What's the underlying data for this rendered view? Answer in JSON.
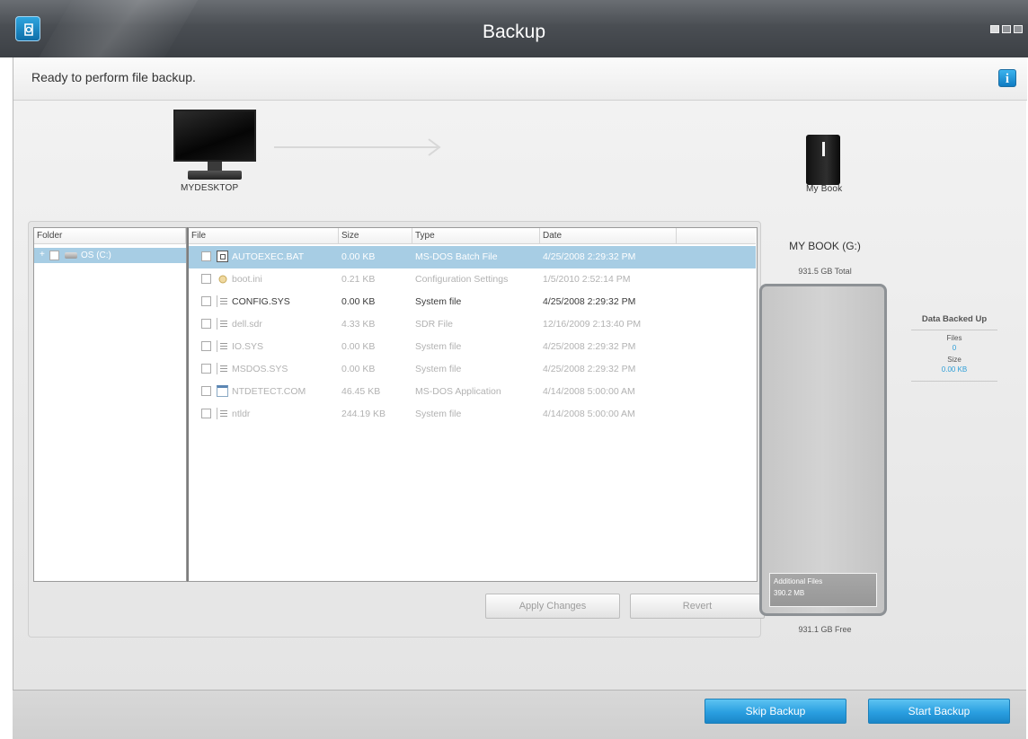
{
  "window": {
    "title": "Backup"
  },
  "status": {
    "text": "Ready to perform file backup."
  },
  "info_button": {
    "label": "i"
  },
  "devices": {
    "source": "MYDESKTOP",
    "destination": "My Book"
  },
  "browser": {
    "folder_header": "Folder",
    "tree": [
      {
        "label": "OS (C:)",
        "expander": "+"
      }
    ],
    "columns": [
      "File",
      "Size",
      "Type",
      "Date"
    ],
    "rows": [
      {
        "name": "AUTOEXEC.BAT",
        "size": "0.00 KB",
        "type": "MS-DOS Batch File",
        "date": "4/25/2008 2:29:32 PM",
        "icon": "batch-file-icon"
      },
      {
        "name": "boot.ini",
        "size": "0.21 KB",
        "type": "Configuration Settings",
        "date": "1/5/2010 2:52:14 PM",
        "icon": "settings-file-icon"
      },
      {
        "name": "CONFIG.SYS",
        "size": "0.00 KB",
        "type": "System file",
        "date": "4/25/2008 2:29:32 PM",
        "icon": "system-file-icon"
      },
      {
        "name": "dell.sdr",
        "size": "4.33 KB",
        "type": "SDR File",
        "date": "12/16/2009 2:13:40 PM",
        "icon": "text-file-icon"
      },
      {
        "name": "IO.SYS",
        "size": "0.00 KB",
        "type": "System file",
        "date": "4/25/2008 2:29:32 PM",
        "icon": "system-file-icon"
      },
      {
        "name": "MSDOS.SYS",
        "size": "0.00 KB",
        "type": "System file",
        "date": "4/25/2008 2:29:32 PM",
        "icon": "system-file-icon"
      },
      {
        "name": "NTDETECT.COM",
        "size": "46.45 KB",
        "type": "MS-DOS Application",
        "date": "4/14/2008 5:00:00 AM",
        "icon": "application-icon"
      },
      {
        "name": "ntldr",
        "size": "244.19 KB",
        "type": "System file",
        "date": "4/14/2008 5:00:00 AM",
        "icon": "system-file-icon"
      }
    ],
    "apply_label": "Apply Changes",
    "revert_label": "Revert"
  },
  "capacity": {
    "drive_name": "MY BOOK (G:)",
    "total": "931.5 GB Total",
    "additional_label": "Additional Files",
    "additional_size": "390.2 MB",
    "free": "931.1 GB Free"
  },
  "data_backed_up": {
    "title": "Data Backed Up",
    "files_label": "Files",
    "files_value": "0",
    "size_label": "Size",
    "size_value": "0.00 KB"
  },
  "footer": {
    "skip_label": "Skip Backup",
    "start_label": "Start Backup"
  },
  "colors": {
    "accent": "#2a9fe0",
    "selection": "#a7cde4",
    "titlebar": "#4a4e53"
  }
}
